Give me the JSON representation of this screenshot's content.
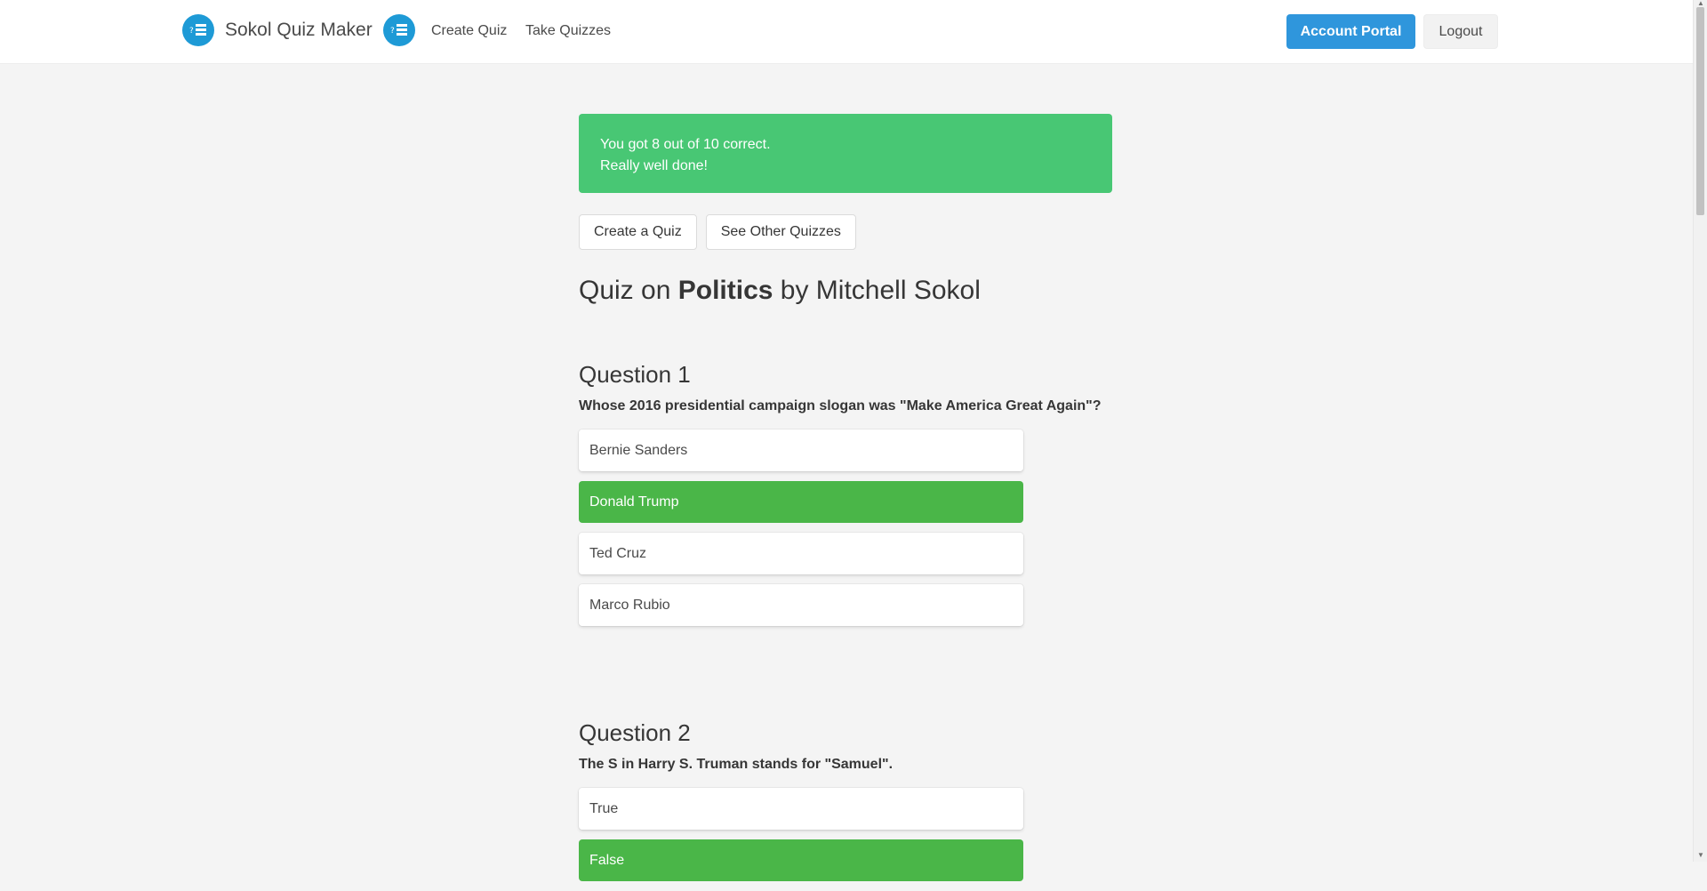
{
  "header": {
    "brand_title": "Sokol Quiz Maker",
    "nav_create": "Create Quiz",
    "nav_take": "Take Quizzes",
    "account_portal": "Account Portal",
    "logout": "Logout"
  },
  "result": {
    "line1": "You got 8 out of 10 correct.",
    "line2": "Really well done!"
  },
  "actions": {
    "create": "Create a Quiz",
    "see_other": "See Other Quizzes"
  },
  "quiz": {
    "title_prefix": "Quiz on ",
    "topic": "Politics",
    "title_suffix": " by Mitchell Sokol"
  },
  "questions": [
    {
      "heading": "Question 1",
      "text": "Whose 2016 presidential campaign slogan was \"Make America Great Again\"?",
      "answers": [
        "Bernie Sanders",
        "Donald Trump",
        "Ted Cruz",
        "Marco Rubio"
      ],
      "correct_index": 1
    },
    {
      "heading": "Question 2",
      "text": "The S in Harry S. Truman stands for \"Samuel\".",
      "answers": [
        "True",
        "False"
      ],
      "correct_index": 1
    }
  ],
  "colors": {
    "accent": "#2f96dc",
    "success": "#48c774",
    "correct_answer": "#4ab648",
    "logo": "#1e9ad6"
  }
}
